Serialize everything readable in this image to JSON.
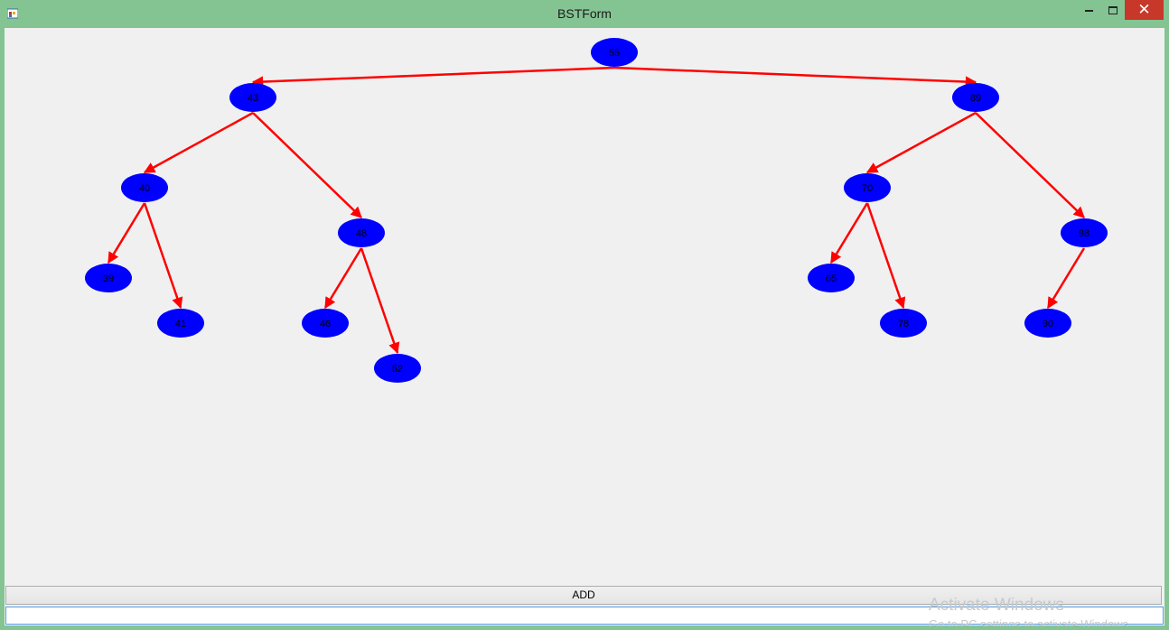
{
  "window": {
    "title": "BSTForm"
  },
  "controls": {
    "close_glyph": "✕",
    "add_label": "ADD",
    "input_value": ""
  },
  "watermark": {
    "line1": "Activate Windows",
    "line2": "Go to PC settings to activate Windows."
  },
  "tree": {
    "node_color": "#0000ff",
    "edge_color": "#ff0000",
    "nodes": [
      {
        "id": "n55",
        "value": "55"
      },
      {
        "id": "n43",
        "value": "43"
      },
      {
        "id": "n89",
        "value": "89"
      },
      {
        "id": "n40",
        "value": "40"
      },
      {
        "id": "n48",
        "value": "48"
      },
      {
        "id": "n70",
        "value": "70"
      },
      {
        "id": "n98",
        "value": "98"
      },
      {
        "id": "n39",
        "value": "39"
      },
      {
        "id": "n41",
        "value": "41"
      },
      {
        "id": "n46",
        "value": "46"
      },
      {
        "id": "n52",
        "value": "52"
      },
      {
        "id": "n65",
        "value": "65"
      },
      {
        "id": "n78",
        "value": "78"
      },
      {
        "id": "n90",
        "value": "90"
      }
    ],
    "edges": [
      {
        "from": "n55",
        "to": "n43"
      },
      {
        "from": "n55",
        "to": "n89"
      },
      {
        "from": "n43",
        "to": "n40"
      },
      {
        "from": "n43",
        "to": "n48"
      },
      {
        "from": "n89",
        "to": "n70"
      },
      {
        "from": "n89",
        "to": "n98"
      },
      {
        "from": "n40",
        "to": "n39"
      },
      {
        "from": "n40",
        "to": "n41"
      },
      {
        "from": "n48",
        "to": "n46"
      },
      {
        "from": "n48",
        "to": "n52"
      },
      {
        "from": "n70",
        "to": "n65"
      },
      {
        "from": "n70",
        "to": "n78"
      },
      {
        "from": "n98",
        "to": "n90"
      }
    ]
  }
}
